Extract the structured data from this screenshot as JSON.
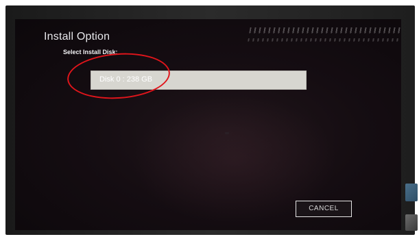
{
  "dialog": {
    "title": "Install Option",
    "subtitle": "Select Install Disk:",
    "disks": [
      {
        "label": "Disk 0 : 238 GB"
      }
    ],
    "cancel_label": "CANCEL"
  },
  "colors": {
    "screen_background": "#150d12",
    "disk_option_background": "#d7d6d0",
    "annotation_circle": "#e0151b",
    "text": "#e8e8ec"
  }
}
